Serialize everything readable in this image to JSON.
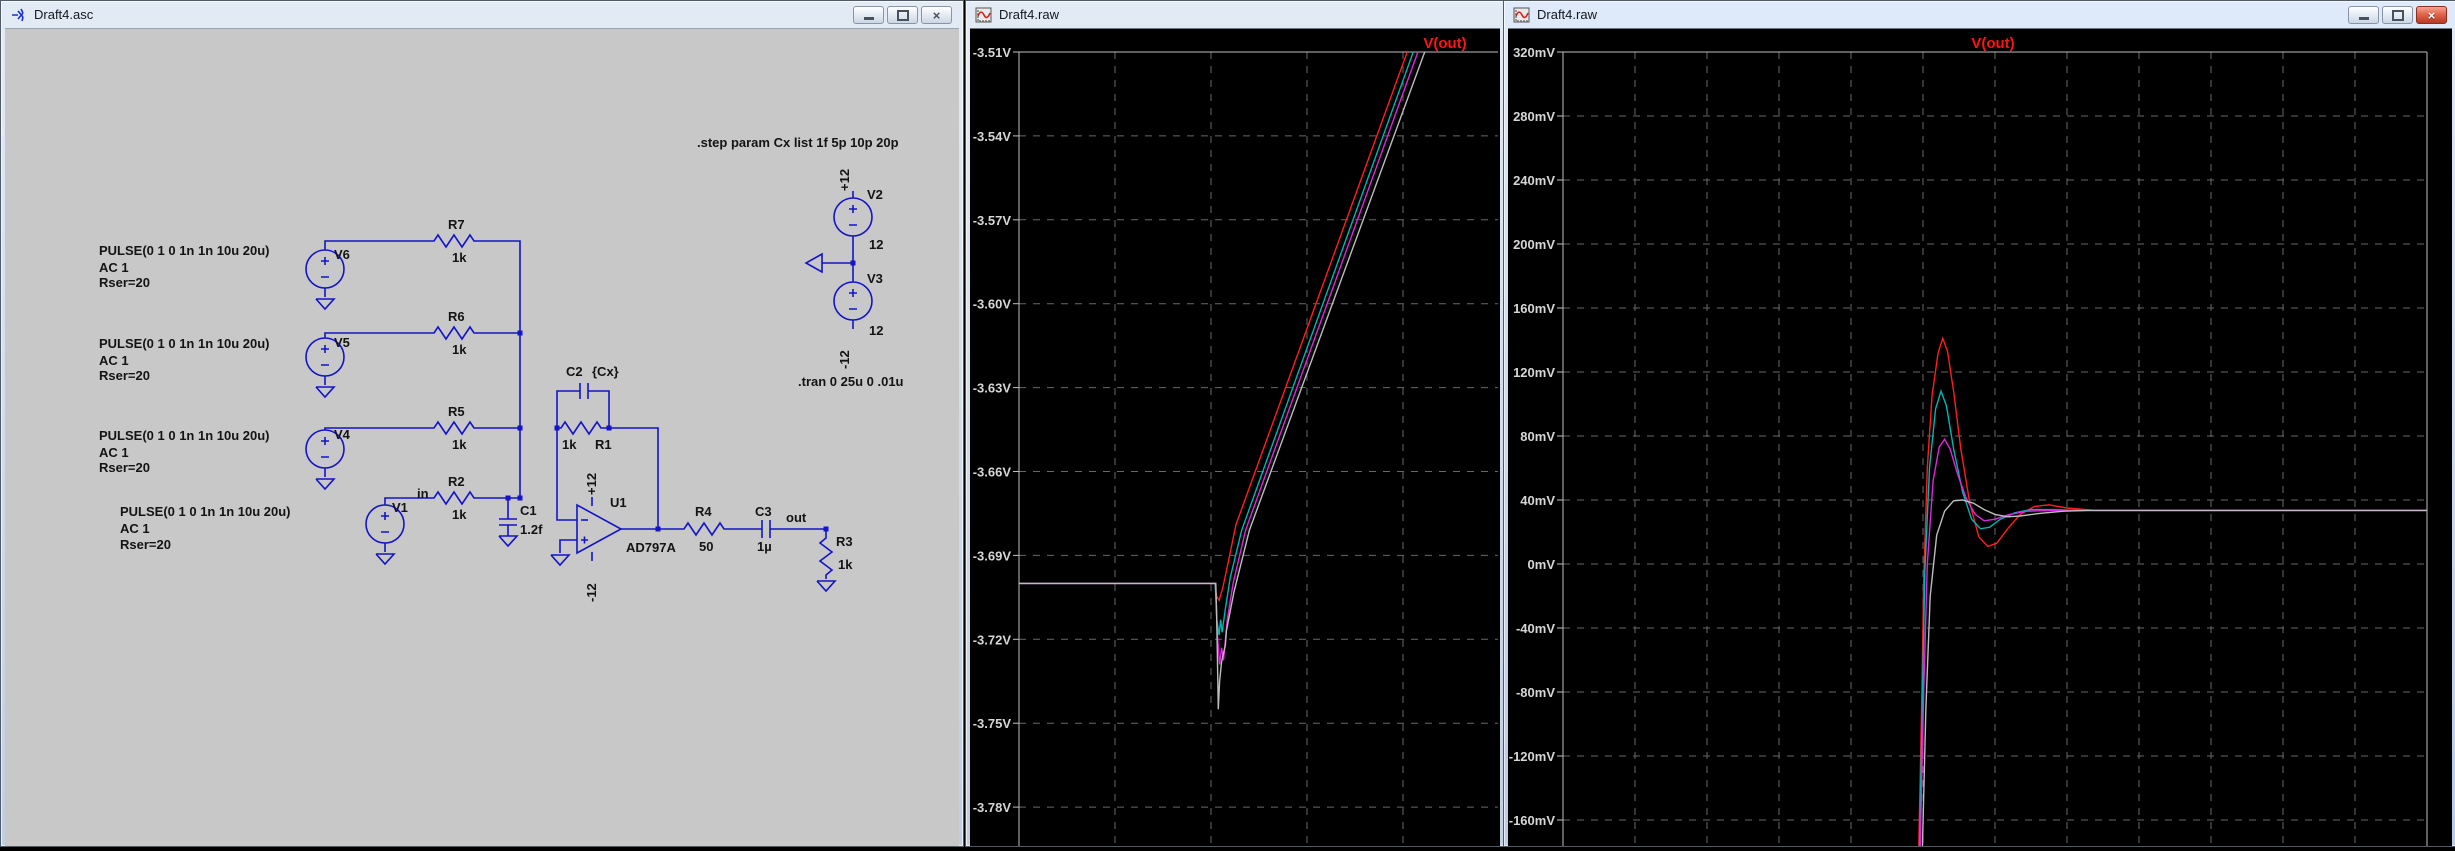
{
  "chrome": {
    "minimize_icon": "minimize-icon",
    "restore_icon": "restore-icon",
    "close_glyph": "×"
  },
  "windows": {
    "schematic_window": {
      "title": "Draft4.asc"
    },
    "wave_window_left": {
      "title": "Draft4.raw"
    },
    "wave_window_right": {
      "title": "Draft4.raw"
    }
  },
  "schematic": {
    "directives": {
      "step": ".step param Cx list 1f 5p 10p  20p",
      "tran": ".tran 0 25u 0 .01u"
    },
    "sources": [
      {
        "name": "V6",
        "spec": [
          "PULSE(0 1 0 1n 1n 10u 20u)",
          "AC 1",
          "Rser=20"
        ]
      },
      {
        "name": "V5",
        "spec": [
          "PULSE(0 1 0 1n 1n 10u 20u)",
          "AC 1",
          "Rser=20"
        ]
      },
      {
        "name": "V4",
        "spec": [
          "PULSE(0 1 0 1n 1n 10u 20u)",
          "AC 1",
          "Rser=20"
        ]
      },
      {
        "name": "V1",
        "spec": [
          "PULSE(0 1 0 1n 1n 10u 20u)",
          "AC 1",
          "Rser=20"
        ]
      }
    ],
    "resistors": {
      "r7": {
        "name": "R7",
        "value": "1k"
      },
      "r6": {
        "name": "R6",
        "value": "1k"
      },
      "r5": {
        "name": "R5",
        "value": "1k"
      },
      "r2": {
        "name": "R2",
        "value": "1k"
      },
      "r1": {
        "name": "R1",
        "value": "1k"
      },
      "r4": {
        "name": "R4",
        "value": "50"
      },
      "r3": {
        "name": "R3",
        "value": "1k"
      }
    },
    "capacitors": {
      "c2": {
        "name": "C2",
        "value": "{Cx}"
      },
      "c1": {
        "name": "C1",
        "value": "1.2f"
      },
      "c3": {
        "name": "C3",
        "value": "1µ"
      }
    },
    "opamp": {
      "name": "U1",
      "part": "AD797A",
      "vplus": "+12",
      "vminus": "-12"
    },
    "nets": {
      "in": "in",
      "out": "out"
    },
    "rails": {
      "vtop": {
        "name": "V2",
        "value": "12",
        "node": "+12"
      },
      "vbot": {
        "name": "V3",
        "value": "12",
        "node": "-12"
      }
    }
  },
  "chart_data": [
    {
      "type": "line",
      "window": "Draft4.raw (middle window)",
      "title": "V(out)",
      "legend": "V(out)",
      "legend_color": "#ff1414",
      "grid": true,
      "legend_pos": "top-center",
      "yunit": "V",
      "ylim": [
        -3.795,
        -3.505
      ],
      "y_ticks": [
        "-3.51V",
        "-3.54V",
        "-3.57V",
        "-3.60V",
        "-3.63V",
        "-3.66V",
        "-3.69V",
        "-3.72V",
        "-3.75V",
        "-3.78V"
      ],
      "y_tick_values": [
        -3.51,
        -3.54,
        -3.57,
        -3.6,
        -3.63,
        -3.66,
        -3.69,
        -3.72,
        -3.75,
        -3.78
      ],
      "x_axis_labels_visible": false,
      "x_estimated_us": [
        0,
        25
      ],
      "x_gridlines_us": [
        5,
        10,
        15,
        20
      ],
      "series": [
        {
          "name": "run1-red",
          "color": "#ff1e1e",
          "points": [
            [
              0,
              -3.7
            ],
            [
              10.2,
              -3.7
            ],
            [
              10.28,
              -3.7045
            ],
            [
              10.42,
              -3.706
            ],
            [
              10.6,
              -3.702
            ],
            [
              10.85,
              -3.694
            ],
            [
              11.3,
              -3.679
            ],
            [
              21.8,
              -3.48
            ]
          ]
        },
        {
          "name": "run2-teal",
          "color": "#00b4b4",
          "points": [
            [
              0,
              -3.7
            ],
            [
              10.22,
              -3.7
            ],
            [
              10.3,
              -3.713
            ],
            [
              10.42,
              -3.7185
            ],
            [
              10.5,
              -3.713
            ],
            [
              10.58,
              -3.7175
            ],
            [
              10.75,
              -3.709
            ],
            [
              11.0,
              -3.698
            ],
            [
              11.6,
              -3.681
            ],
            [
              22.1,
              -3.48
            ]
          ]
        },
        {
          "name": "run3-magenta",
          "color": "#dc28dc",
          "points": [
            [
              0,
              -3.7
            ],
            [
              10.24,
              -3.7
            ],
            [
              10.33,
              -3.718
            ],
            [
              10.45,
              -3.729
            ],
            [
              10.55,
              -3.723
            ],
            [
              10.65,
              -3.7275
            ],
            [
              10.85,
              -3.713
            ],
            [
              11.15,
              -3.7
            ],
            [
              11.8,
              -3.681
            ],
            [
              22.35,
              -3.48
            ]
          ]
        },
        {
          "name": "run4-gray",
          "color": "#bdbdbd",
          "points": [
            [
              0,
              -3.7
            ],
            [
              10.25,
              -3.7
            ],
            [
              10.3,
              -3.714
            ],
            [
              10.38,
              -3.745
            ],
            [
              10.45,
              -3.735
            ],
            [
              10.55,
              -3.728
            ],
            [
              10.75,
              -3.722
            ],
            [
              10.8,
              -3.717
            ],
            [
              11.2,
              -3.703
            ],
            [
              12.0,
              -3.681
            ],
            [
              23.0,
              -3.475
            ]
          ]
        }
      ]
    },
    {
      "type": "line",
      "window": "Draft4.raw (right window)",
      "title": "V(out)",
      "legend": "V(out)",
      "legend_color": "#ff1414",
      "grid": true,
      "legend_pos": "top-center",
      "yunit": "mV",
      "ylim": [
        -185,
        320
      ],
      "y_ticks": [
        "320mV",
        "280mV",
        "240mV",
        "200mV",
        "160mV",
        "120mV",
        "80mV",
        "40mV",
        "0mV",
        "-40mV",
        "-80mV",
        "-120mV",
        "-160mV"
      ],
      "y_tick_values": [
        320,
        280,
        240,
        200,
        160,
        120,
        80,
        40,
        0,
        -40,
        -80,
        -120,
        -160
      ],
      "x_axis_labels_visible": false,
      "x_estimated_us": [
        0,
        24
      ],
      "x_gridlines_us": [
        2,
        4,
        6,
        8,
        10,
        12,
        14,
        16,
        18,
        20,
        22
      ],
      "series": [
        {
          "name": "run1-red",
          "color": "#ff1e1e",
          "points": [
            [
              9.88,
              -180
            ],
            [
              9.96,
              -90
            ],
            [
              10.02,
              -10
            ],
            [
              10.12,
              60
            ],
            [
              10.25,
              105
            ],
            [
              10.42,
              132
            ],
            [
              10.55,
              141
            ],
            [
              10.68,
              133
            ],
            [
              10.85,
              108
            ],
            [
              11.05,
              72
            ],
            [
              11.3,
              38
            ],
            [
              11.55,
              17
            ],
            [
              11.8,
              11
            ],
            [
              12.05,
              13
            ],
            [
              12.35,
              22
            ],
            [
              12.7,
              31
            ],
            [
              13.1,
              36
            ],
            [
              13.5,
              37
            ],
            [
              14.0,
              35
            ],
            [
              14.8,
              33.5
            ],
            [
              24,
              33.5
            ]
          ]
        },
        {
          "name": "run2-teal",
          "color": "#00b4b4",
          "points": [
            [
              9.9,
              -180
            ],
            [
              9.98,
              -90
            ],
            [
              10.05,
              -5
            ],
            [
              10.18,
              60
            ],
            [
              10.35,
              97
            ],
            [
              10.5,
              108
            ],
            [
              10.65,
              99
            ],
            [
              10.85,
              72
            ],
            [
              11.1,
              45
            ],
            [
              11.35,
              28
            ],
            [
              11.6,
              22
            ],
            [
              11.85,
              23
            ],
            [
              12.15,
              28
            ],
            [
              12.55,
              32
            ],
            [
              13.0,
              34
            ],
            [
              13.6,
              34
            ],
            [
              14.3,
              33.5
            ],
            [
              24,
              33.5
            ]
          ]
        },
        {
          "name": "run3-magenta",
          "color": "#dc28dc",
          "points": [
            [
              9.92,
              -180
            ],
            [
              10.02,
              -80
            ],
            [
              10.12,
              0
            ],
            [
              10.28,
              52
            ],
            [
              10.45,
              73
            ],
            [
              10.6,
              78
            ],
            [
              10.75,
              72
            ],
            [
              10.95,
              57
            ],
            [
              11.2,
              41
            ],
            [
              11.45,
              31
            ],
            [
              11.7,
              27
            ],
            [
              12.0,
              28
            ],
            [
              12.4,
              31
            ],
            [
              12.9,
              33
            ],
            [
              13.5,
              33.5
            ],
            [
              24,
              33.5
            ]
          ]
        },
        {
          "name": "run4-gray",
          "color": "#bdbdbd",
          "points": [
            [
              9.98,
              -180
            ],
            [
              10.08,
              -90
            ],
            [
              10.2,
              -20
            ],
            [
              10.38,
              18
            ],
            [
              10.6,
              33
            ],
            [
              10.85,
              39.5
            ],
            [
              11.1,
              40
            ],
            [
              11.4,
              38
            ],
            [
              11.7,
              34
            ],
            [
              12.0,
              31
            ],
            [
              12.35,
              29.5
            ],
            [
              12.7,
              30
            ],
            [
              13.2,
              31.5
            ],
            [
              13.9,
              33
            ],
            [
              14.6,
              33.5
            ],
            [
              24,
              33.5
            ]
          ]
        }
      ]
    }
  ]
}
